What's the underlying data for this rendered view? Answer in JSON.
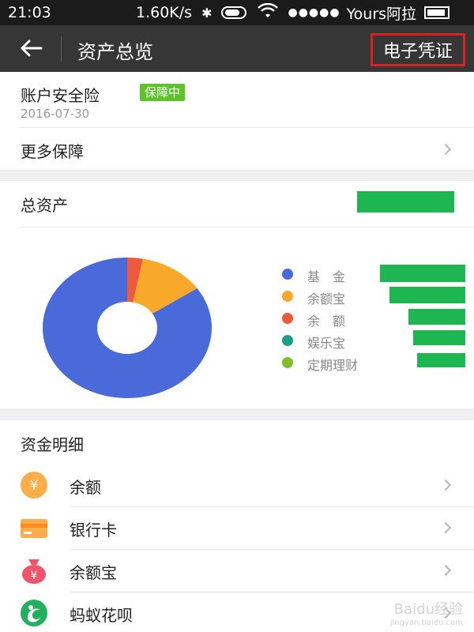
{
  "status_bar": {
    "time": "21:03",
    "speed": "1.60K/s",
    "carrier": "Yours阿拉",
    "icons": [
      "bluetooth-icon",
      "battery-saver-icon",
      "wifi-icon",
      "signal-dots-icon",
      "battery-icon"
    ]
  },
  "nav": {
    "back_icon": "back-arrow-icon",
    "title": "资产总览",
    "voucher_label": "电子凭证",
    "highlight_color": "#e02020"
  },
  "insurance": {
    "name": "账户安全险",
    "badge": "保障中",
    "date": "2016-07-30",
    "more_label": "更多保障"
  },
  "assets": {
    "title": "总资产",
    "total_value": "(hidden)",
    "legend": [
      {
        "label": "基　金",
        "color": "#4a6ad9",
        "value": "(hidden)"
      },
      {
        "label": "余额宝",
        "color": "#f8a92a",
        "value": "(hidden)"
      },
      {
        "label": "余　额",
        "color": "#ef5a3c",
        "value": "(hidden)"
      },
      {
        "label": "娱乐宝",
        "color": "#1aa086",
        "value": "(hidden)"
      },
      {
        "label": "定期理财",
        "color": "#7ec02a",
        "value": "(hidden)"
      }
    ]
  },
  "chart_data": {
    "type": "pie",
    "categories": [
      "基　金",
      "余额宝",
      "余　额",
      "娱乐宝",
      "定期理财"
    ],
    "values": [
      84.5,
      12.5,
      3.0,
      0,
      0
    ],
    "colors": [
      "#4a6ad9",
      "#f8a92a",
      "#ef5a3c",
      "#1aa086",
      "#7ec02a"
    ],
    "donut": true,
    "legend_position": "right"
  },
  "funds": {
    "title": "资金明细",
    "items": [
      {
        "label": "余额",
        "icon": "yuan-coin-icon"
      },
      {
        "label": "银行卡",
        "icon": "bank-card-icon"
      },
      {
        "label": "余额宝",
        "icon": "money-bag-icon"
      },
      {
        "label": "蚂蚁花呗",
        "icon": "huabei-icon"
      }
    ]
  },
  "watermark": {
    "text": "Baidu经验",
    "url": "jingyan.baidu.com"
  }
}
